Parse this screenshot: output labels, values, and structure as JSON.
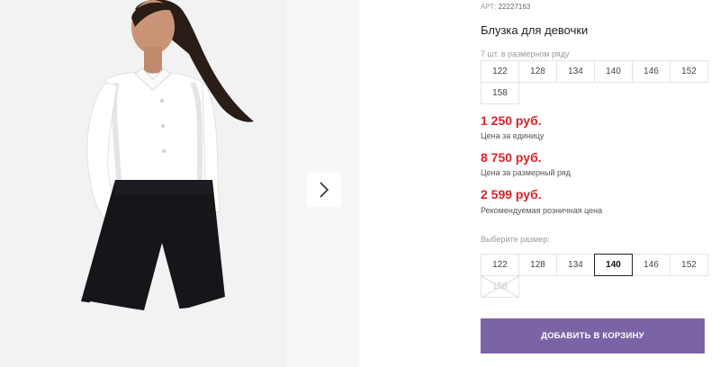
{
  "product": {
    "sku_label": "АРТ:",
    "sku": "22227163",
    "title": "Блузка для девочки"
  },
  "pack": {
    "label": "7 шт. в размерном ряду",
    "sizes": [
      "122",
      "128",
      "134",
      "140",
      "146",
      "152",
      "158"
    ]
  },
  "prices": {
    "unit_price": "1 250 руб.",
    "unit_caption": "Цена за единицу",
    "pack_price": "8 750 руб.",
    "pack_caption": "Цена за размерный ряд",
    "retail_price": "2 599 руб.",
    "retail_caption": "Рекомендуемая розничная цена"
  },
  "size_select": {
    "label": "Выберите размер:",
    "sizes": [
      "122",
      "128",
      "134",
      "140",
      "146",
      "152",
      "158"
    ],
    "selected": "140",
    "unavailable": [
      "158"
    ]
  },
  "cart": {
    "add_label": "ДОБАВИТЬ В КОРЗИНУ"
  },
  "colors": {
    "accent": "#7b64a5",
    "price": "#d8232a"
  }
}
